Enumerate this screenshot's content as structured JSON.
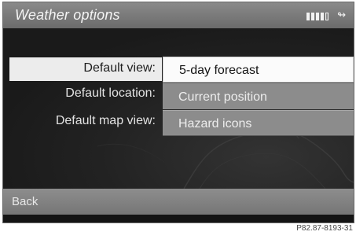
{
  "title_bar": {
    "title": "Weather options",
    "signal_icon": "signal-strength-icon",
    "call_icon": "phone-call-icon"
  },
  "settings": [
    {
      "label": "Default view:",
      "value": "5-day forecast",
      "selected": true
    },
    {
      "label": "Default location:",
      "value": "Current position",
      "selected": false
    },
    {
      "label": "Default map view:",
      "value": "Hazard icons",
      "selected": false
    }
  ],
  "back": {
    "label": "Back"
  },
  "reference_code": "P82.87-8193-31",
  "colors": {
    "highlight": "#ececec",
    "option_bg": "#8c8c8c",
    "bar_bg": "#7a7a7a",
    "screen_bg": "#1e1e1e"
  }
}
